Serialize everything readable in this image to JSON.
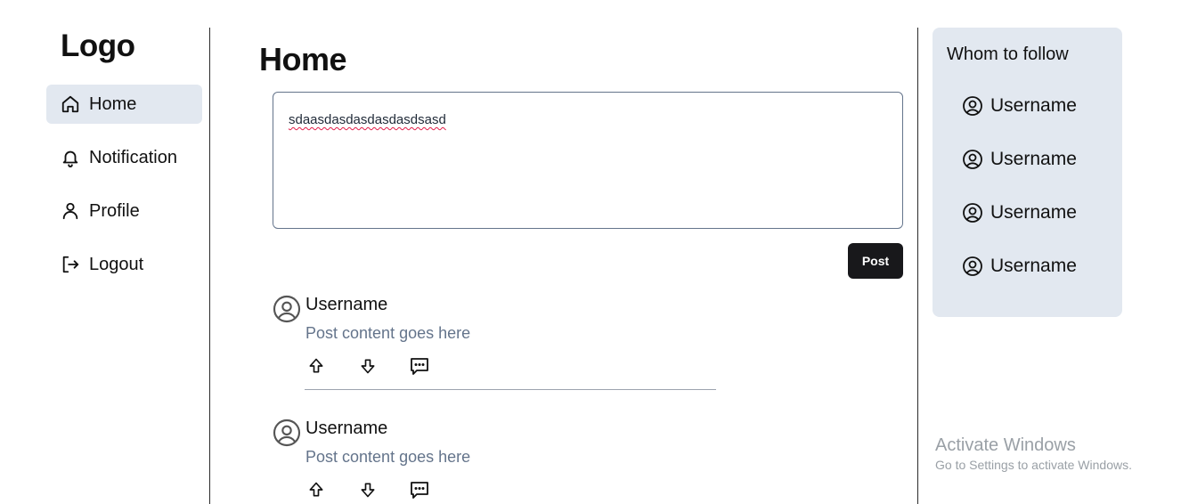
{
  "sidebar": {
    "logo": "Logo",
    "items": [
      {
        "label": "Home",
        "icon": "home-icon",
        "active": true
      },
      {
        "label": "Notification",
        "icon": "bell-icon",
        "active": false
      },
      {
        "label": "Profile",
        "icon": "user-icon",
        "active": false
      },
      {
        "label": "Logout",
        "icon": "logout-icon",
        "active": false
      }
    ]
  },
  "main": {
    "title": "Home",
    "composer": {
      "value": "sdaasdasdasdasdasdsasd"
    },
    "post_button": "Post",
    "posts": [
      {
        "username": "Username",
        "content": "Post content goes here",
        "avatar_icon": "user-circle-icon",
        "actions": [
          "arrow-up-icon",
          "arrow-down-icon",
          "comment-icon"
        ]
      },
      {
        "username": "Username",
        "content": "Post content goes here",
        "avatar_icon": "user-circle-icon",
        "actions": [
          "arrow-up-icon",
          "arrow-down-icon",
          "comment-icon"
        ]
      }
    ]
  },
  "right": {
    "title": "Whom to follow",
    "users": [
      {
        "username": "Username",
        "icon": "user-circle-icon"
      },
      {
        "username": "Username",
        "icon": "user-circle-icon"
      },
      {
        "username": "Username",
        "icon": "user-circle-icon"
      },
      {
        "username": "Username",
        "icon": "user-circle-icon"
      }
    ]
  },
  "watermark": {
    "line1": "Activate Windows",
    "line2": "Go to Settings to activate Windows."
  },
  "colors": {
    "active_bg": "#e2e8f0",
    "button_bg": "#18181b",
    "muted_text": "#64748b",
    "follow_card_bg": "#e2e8f0"
  }
}
